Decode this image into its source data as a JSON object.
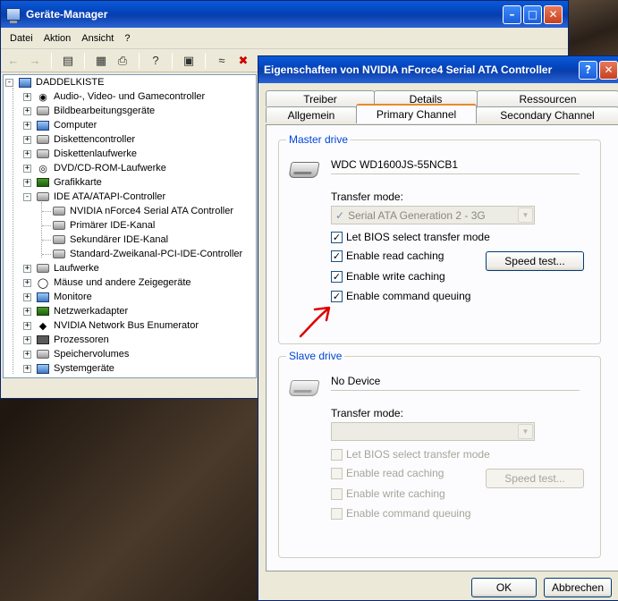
{
  "device_manager": {
    "title": "Geräte-Manager",
    "menu": [
      "Datei",
      "Aktion",
      "Ansicht",
      "?"
    ],
    "tree": {
      "root": "DADDELKISTE",
      "items": [
        {
          "label": "Audio-, Video- und Gamecontroller",
          "icon": "audio-icon"
        },
        {
          "label": "Bildbearbeitungsgeräte",
          "icon": "camera-icon"
        },
        {
          "label": "Computer",
          "icon": "computer-icon"
        },
        {
          "label": "Diskettencontroller",
          "icon": "floppy-controller-icon"
        },
        {
          "label": "Diskettenlaufwerke",
          "icon": "floppy-drive-icon"
        },
        {
          "label": "DVD/CD-ROM-Laufwerke",
          "icon": "cdrom-icon"
        },
        {
          "label": "Grafikkarte",
          "icon": "display-adapter-icon"
        },
        {
          "label": "IDE ATA/ATAPI-Controller",
          "icon": "ide-controller-icon",
          "children": [
            "NVIDIA nForce4 Serial ATA Controller",
            "Primärer IDE-Kanal",
            "Sekundärer IDE-Kanal",
            "Standard-Zweikanal-PCI-IDE-Controller"
          ]
        },
        {
          "label": "Laufwerke",
          "icon": "disk-drive-icon"
        },
        {
          "label": "Mäuse und andere Zeigegeräte",
          "icon": "mouse-icon"
        },
        {
          "label": "Monitore",
          "icon": "monitor-icon"
        },
        {
          "label": "Netzwerkadapter",
          "icon": "network-adapter-icon"
        },
        {
          "label": "NVIDIA Network Bus Enumerator",
          "icon": "network-bus-icon"
        },
        {
          "label": "Prozessoren",
          "icon": "processor-icon"
        },
        {
          "label": "Speichervolumes",
          "icon": "storage-volume-icon"
        },
        {
          "label": "Systemgeräte",
          "icon": "system-device-icon"
        }
      ]
    }
  },
  "dialog": {
    "title": "Eigenschaften von NVIDIA nForce4 Serial ATA Controller",
    "tabs_back": [
      "Treiber",
      "Details",
      "Ressourcen"
    ],
    "tabs_front": [
      "Allgemein",
      "Primary Channel",
      "Secondary Channel"
    ],
    "active_tab": "Primary Channel",
    "master": {
      "group_title": "Master drive",
      "device": "WDC WD1600JS-55NCB1",
      "transfer_label": "Transfer mode:",
      "transfer_value": "Serial ATA Generation 2 - 3G",
      "options": [
        {
          "label": "Let BIOS select transfer mode",
          "checked": true
        },
        {
          "label": "Enable read caching",
          "checked": true
        },
        {
          "label": "Enable write caching",
          "checked": true
        },
        {
          "label": "Enable command queuing",
          "checked": true
        }
      ],
      "speed_button": "Speed test..."
    },
    "slave": {
      "group_title": "Slave drive",
      "device": "No Device",
      "transfer_label": "Transfer mode:",
      "transfer_value": "",
      "options": [
        {
          "label": "Let BIOS select transfer mode",
          "checked": false
        },
        {
          "label": "Enable read caching",
          "checked": false
        },
        {
          "label": "Enable write caching",
          "checked": false
        },
        {
          "label": "Enable command queuing",
          "checked": false
        }
      ],
      "speed_button": "Speed test..."
    },
    "ok_label": "OK",
    "cancel_label": "Abbrechen"
  },
  "colors": {
    "titlebar": "#0a46c8",
    "group_title": "#0046d5",
    "tab_highlight": "#e68b2c",
    "annotation": "#e00000"
  }
}
